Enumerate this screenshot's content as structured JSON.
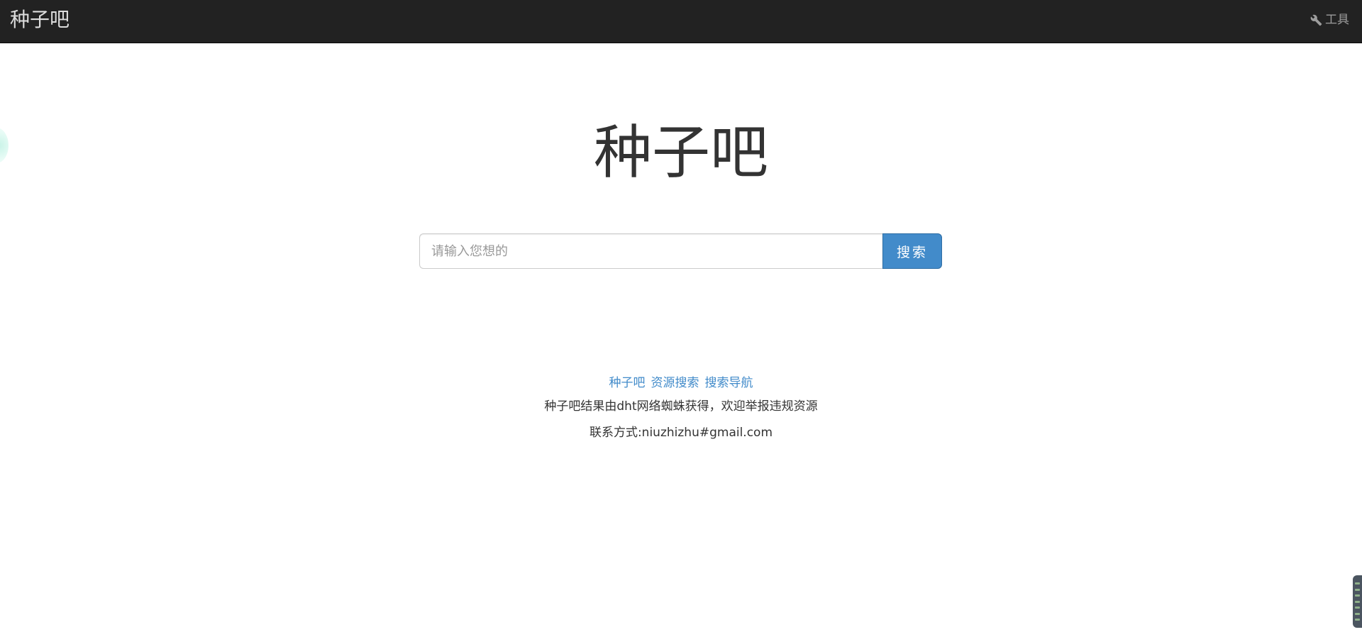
{
  "navbar": {
    "brand": "种子吧",
    "tools_label": "工具",
    "tools_icon": "wrench-icon"
  },
  "hero": {
    "title": "种子吧"
  },
  "search": {
    "placeholder": "请输入您想的",
    "value": "",
    "button_label": "搜索"
  },
  "footer": {
    "links": [
      "种子吧",
      "资源搜索",
      "搜索导航"
    ],
    "description": "种子吧结果由dht网络蜘蛛获得，欢迎举报违规资源",
    "contact": "联系方式:niuzhizhu#gmail.com"
  },
  "colors": {
    "navbar_bg": "#222222",
    "brand_text": "#dddddd",
    "accent": "#428bca",
    "link": "#428bca",
    "text": "#333333"
  }
}
